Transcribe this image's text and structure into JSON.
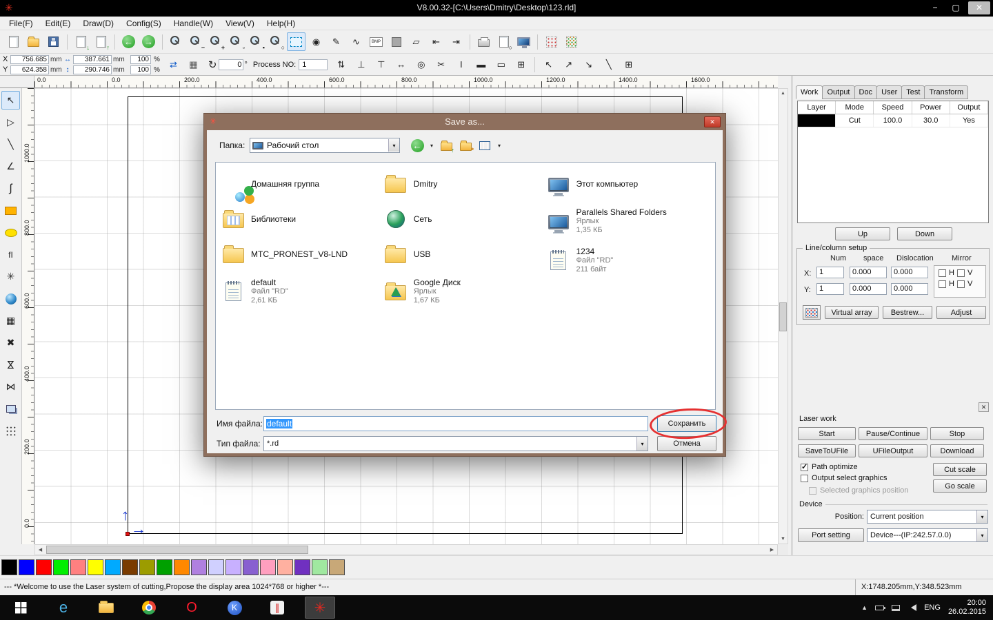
{
  "ui": {
    "logo_glyph": "✳",
    "close_glyph": "✕",
    "dropdown_arrow": "▾",
    "chevron_up": "▲",
    "scroll_left": "◀",
    "scroll_right": "▶",
    "scroll_up": "▲",
    "scroll_down": "▼"
  },
  "titlebar": {
    "title": "V8.00.32-[C:\\Users\\Dmitry\\Desktop\\123.rld]",
    "minimize": "−",
    "maximize": "▢",
    "close": "✕"
  },
  "menubar": {
    "items": [
      {
        "id": "file",
        "label": "File(F)"
      },
      {
        "id": "edit",
        "label": "Edit(E)"
      },
      {
        "id": "draw",
        "label": "Draw(D)"
      },
      {
        "id": "config",
        "label": "Config(S)"
      },
      {
        "id": "handle",
        "label": "Handle(W)"
      },
      {
        "id": "view",
        "label": "View(V)"
      },
      {
        "id": "help",
        "label": "Help(H)"
      }
    ]
  },
  "toolbar_main": {
    "icons": [
      {
        "n": "new-file-icon",
        "cls": "i-page"
      },
      {
        "n": "open-file-icon",
        "cls": "i-folder"
      },
      {
        "n": "save-file-icon",
        "cls": "i-floppy"
      },
      {
        "sep": true
      },
      {
        "n": "import-file-icon",
        "cls": "i-page",
        "g": "↓",
        "gc": "#1a8a1a",
        "p": "br"
      },
      {
        "n": "export-file-icon",
        "cls": "i-page",
        "g": "↑",
        "gc": "#1a8a1a",
        "p": "br"
      },
      {
        "sep": true
      },
      {
        "n": "view-back-icon",
        "cls": "i-circle-green",
        "g": "←",
        "gc": "#ffffff"
      },
      {
        "n": "view-forward-icon",
        "cls": "i-circle-green",
        "g": "→",
        "gc": "#ffffff"
      },
      {
        "sep": true
      },
      {
        "n": "zoom-window-icon",
        "cls": "i-mag"
      },
      {
        "n": "zoom-out-icon",
        "cls": "i-mag",
        "g": "−",
        "p": "br"
      },
      {
        "n": "zoom-in-icon",
        "cls": "i-mag",
        "g": "+",
        "p": "br"
      },
      {
        "n": "zoom-selection-icon",
        "cls": "i-mag",
        "g": "▫",
        "p": "br"
      },
      {
        "n": "zoom-page-icon",
        "cls": "i-mag",
        "g": "▪",
        "p": "br"
      },
      {
        "n": "zoom-all-icon",
        "cls": "i-mag",
        "g": "○",
        "p": "br"
      },
      {
        "n": "select-tool-icon",
        "cls": "i-selrect",
        "active": true
      },
      {
        "n": "node-tool-icon",
        "g": "◉"
      },
      {
        "n": "pen-tool-icon",
        "g": "✎"
      },
      {
        "n": "curve-tool-icon",
        "g": "∿"
      },
      {
        "n": "bmp-tool-icon",
        "cls": "i-bmpbox",
        "g": "BMP",
        "fs": 6
      },
      {
        "n": "fill-tool-icon",
        "cls": "i-graysq"
      },
      {
        "n": "edit-rect-icon",
        "g": "▱"
      },
      {
        "n": "dim-horizontal-icon",
        "g": "⇤"
      },
      {
        "n": "dim-vertical-icon",
        "g": "⇥"
      },
      {
        "sep": true
      },
      {
        "n": "print-icon",
        "cls": "i-printer"
      },
      {
        "n": "preview-icon",
        "cls": "i-page",
        "g": "○",
        "p": "br"
      },
      {
        "n": "display-icon",
        "cls": "i-monitor"
      },
      {
        "sep": true
      },
      {
        "n": "output-array-icon",
        "cls": "i-array1"
      },
      {
        "n": "preview-array-icon",
        "cls": "i-array2"
      }
    ]
  },
  "coords": {
    "x_label": "X",
    "y_label": "Y",
    "unit": "mm",
    "x_val1": "756.685",
    "x_val2": "387.661",
    "y_val1": "624.358",
    "y_val2": "290.746",
    "h_arrow": "↔",
    "v_arrow": "↕",
    "scale_x": "100",
    "scale_y": "100",
    "percent": "%",
    "rotate_icon": "↻",
    "rotate_val": "0",
    "degree": "°",
    "process_label": "Process NO:",
    "process_val": "1"
  },
  "toolbar_pre": {
    "icons": [
      {
        "n": "swap-xy-icon",
        "g": "⇄",
        "gc": "#0a58c8"
      },
      {
        "n": "size-table-icon",
        "g": "▦",
        "gc": "#555555"
      }
    ]
  },
  "toolbar_align": {
    "icons": [
      {
        "n": "flip-vertical-icon",
        "g": "⇅"
      },
      {
        "n": "align-bottom-icon",
        "g": "⊥"
      },
      {
        "n": "align-top-icon",
        "g": "⊤"
      },
      {
        "n": "distribute-horizontal-icon",
        "g": "↔"
      },
      {
        "n": "align-center-icon",
        "g": "◎"
      },
      {
        "n": "cut-path-icon",
        "g": "✂"
      },
      {
        "n": "text-cursor-icon",
        "g": "I"
      },
      {
        "n": "solid-rect-icon",
        "g": "▬"
      },
      {
        "n": "hollow-rect-icon",
        "g": "▭"
      },
      {
        "n": "grid-rect-icon",
        "g": "⊞"
      },
      {
        "sep": true
      },
      {
        "n": "corner-topleft-icon",
        "g": "↖"
      },
      {
        "n": "corner-topright-icon",
        "g": "↗"
      },
      {
        "n": "corner-bottomright-icon",
        "g": "↘"
      },
      {
        "n": "diagonal-icon",
        "g": "╲"
      },
      {
        "n": "align-grid-icon",
        "g": "⊞"
      }
    ]
  },
  "left_toolbar": {
    "icons": [
      {
        "n": "select-icon",
        "g": "↖",
        "active": true
      },
      {
        "n": "node-edit-icon",
        "g": "▷"
      },
      {
        "n": "draw-line-icon",
        "g": "╲"
      },
      {
        "n": "draw-polyline-icon",
        "g": "∠"
      },
      {
        "n": "draw-curve-icon",
        "g": "ʃ",
        "fs": 16
      },
      {
        "n": "draw-rectangle-icon",
        "cls": "i-rect-orange"
      },
      {
        "n": "draw-ellipse-icon",
        "cls": "i-ellipse-yellow"
      },
      {
        "n": "draw-text-icon",
        "g": "fI",
        "fs": 12
      },
      {
        "n": "draw-star-icon",
        "g": "✳",
        "gc": "#333333"
      },
      {
        "n": "capture-icon",
        "cls": "i-ball"
      },
      {
        "n": "grid-array-icon",
        "g": "▦"
      },
      {
        "n": "delete-icon",
        "g": "✖",
        "gc": "#222222"
      },
      {
        "n": "mirror-vertical-icon",
        "g": "⋈",
        "rot": 90
      },
      {
        "n": "mirror-horizontal-icon",
        "g": "⋈"
      },
      {
        "n": "offset-icon",
        "cls": "i-two-rects"
      },
      {
        "n": "array-copy-icon",
        "cls": "i-dots-grid"
      }
    ]
  },
  "rulers": {
    "h": [
      "0.0",
      "0.0",
      "200.0",
      "400.0",
      "600.0",
      "800.0",
      "1000.0",
      "1200.0",
      "1400.0",
      "1600.0"
    ],
    "v": [
      "1000.0",
      "800.0",
      "600.0",
      "400.0",
      "200.0",
      "0.0"
    ]
  },
  "dialog": {
    "title": "Save as...",
    "folder_label": "Папка:",
    "folder_value": "Рабочий стол",
    "nav_icons": [
      {
        "n": "back-icon",
        "cls": "i-circle-green",
        "g": "←",
        "gc": "#ffffff"
      },
      {
        "n": "back-dropdown-icon",
        "g": "▾",
        "fs": 8,
        "slim": true
      },
      {
        "n": "up-folder-icon",
        "cls": "i-folder",
        "g": "↑",
        "gc": "#1a8a1a",
        "p": "br"
      },
      {
        "n": "new-folder-icon",
        "cls": "i-folder",
        "g": "*",
        "gc": "#c87800",
        "p": "br"
      },
      {
        "n": "views-icon",
        "cls": "i-views"
      },
      {
        "n": "views-dropdown-icon",
        "g": "▾",
        "fs": 8,
        "slim": true
      }
    ],
    "columns": [
      [
        {
          "id": "homegroup",
          "icon": "homegroup",
          "name": "Домашняя группа"
        },
        {
          "id": "libraries",
          "icon": "library",
          "name": "Библиотеки"
        },
        {
          "id": "mtc-pronest-folder",
          "icon": "folder",
          "name": "MTC_PRONEST_V8-LND"
        },
        {
          "id": "default-rd-file",
          "icon": "notepad",
          "name": "default",
          "details": [
            "Файл \"RD\"",
            "2,61 КБ"
          ]
        }
      ],
      [
        {
          "id": "dmitry-folder",
          "icon": "folder",
          "name": "Dmitry"
        },
        {
          "id": "network",
          "icon": "network",
          "name": "Сеть"
        },
        {
          "id": "usb-folder",
          "icon": "folder",
          "name": "USB"
        },
        {
          "id": "google-drive",
          "icon": "gdrive",
          "name": "Google Диск",
          "details": [
            "Ярлык",
            "1,67 КБ"
          ]
        }
      ],
      [
        {
          "id": "this-pc",
          "icon": "computer",
          "name": "Этот компьютер"
        },
        {
          "id": "parallels-shared-folders",
          "icon": "computer",
          "name": "Parallels Shared Folders",
          "details": [
            "Ярлык",
            "1,35 КБ"
          ]
        },
        {
          "id": "file-1234",
          "icon": "notepad",
          "name": "1234",
          "details": [
            "Файл \"RD\"",
            "211 байт"
          ]
        }
      ]
    ],
    "filename_label": "Имя файла:",
    "filename_value": "default",
    "filetype_label": "Тип файла:",
    "filetype_value": "*.rd",
    "save_label": "Сохранить",
    "cancel_label": "Отмена"
  },
  "right_panel": {
    "tabs": [
      {
        "id": "work",
        "label": "Work",
        "active": true
      },
      {
        "id": "output",
        "label": "Output"
      },
      {
        "id": "doc",
        "label": "Doc"
      },
      {
        "id": "user",
        "label": "User"
      },
      {
        "id": "test",
        "label": "Test"
      },
      {
        "id": "transform",
        "label": "Transform"
      }
    ],
    "layer_table": {
      "headers": [
        "Layer",
        "Mode",
        "Speed",
        "Power",
        "Output"
      ],
      "rows": [
        {
          "layer_color": "#000000",
          "mode": "Cut",
          "speed": "100.0",
          "power": "30.0",
          "output": "Yes"
        }
      ]
    },
    "up_label": "Up",
    "down_label": "Down",
    "line_column_setup": {
      "title": "Line/column setup",
      "col_headers": [
        "Num",
        "space",
        "Dislocation",
        "Mirror"
      ],
      "rows": [
        {
          "axis": "X:",
          "num": "1",
          "space": "0.000",
          "dislocation": "0.000",
          "h_label": "H",
          "v_label": "V",
          "h_checked": false,
          "v_checked": false
        },
        {
          "axis": "Y:",
          "num": "1",
          "space": "0.000",
          "dislocation": "0.000",
          "h_label": "H",
          "v_label": "V",
          "h_checked": false,
          "v_checked": false
        }
      ],
      "virtual_array_label": "Virtual array",
      "bestrew_label": "Bestrew...",
      "adjust_label": "Adjust"
    },
    "laser_work": {
      "title": "Laser work",
      "start_label": "Start",
      "pause_label": "Pause/Continue",
      "stop_label": "Stop",
      "save_ufile_label": "SaveToUFile",
      "ufile_output_label": "UFileOutput",
      "download_label": "Download",
      "path_optimize": {
        "label": "Path optimize",
        "checked": true
      },
      "output_select": {
        "label": "Output select graphics",
        "checked": false
      },
      "selected_position": {
        "label": "Selected graphics position",
        "checked": false
      },
      "cut_scale_label": "Cut scale",
      "go_scale_label": "Go scale"
    },
    "device": {
      "title": "Device",
      "position_label": "Position:",
      "position_value": "Current position",
      "port_setting_label": "Port setting",
      "device_value": "Device---(IP:242.57.0.0)"
    }
  },
  "palette": {
    "colors": [
      "#000000",
      "#0000ff",
      "#ff0000",
      "#00ee00",
      "#ff8080",
      "#ffff00",
      "#00aaff",
      "#7a3b00",
      "#9c9c00",
      "#00a000",
      "#ff8800",
      "#b080e0",
      "#d0d0ff",
      "#c8b0ff",
      "#8860d0",
      "#ff9fbf",
      "#ffb0a0",
      "#7030c0",
      "#a0e8a0",
      "#c8a878"
    ]
  },
  "status_bar": {
    "message": "--- *Welcome to use the Laser system of cutting,Propose the display area 1024*768 or higher *---",
    "coordinates": "X:1748.205mm,Y:348.523mm"
  },
  "taskbar": {
    "apps": [
      {
        "n": "start-button",
        "cls": "ic-win"
      },
      {
        "n": "ie-taskbar-button",
        "cls": "ic-ie-txt",
        "g": "e",
        "gc": "#4db4e8",
        "fs": 22,
        "txt": true
      },
      {
        "n": "explorer-taskbar-button",
        "cls": "ic-explorer"
      },
      {
        "n": "chrome-taskbar-button",
        "cls": "ic-chrome"
      },
      {
        "n": "opera-taskbar-button",
        "cls": "ic-opera-txt",
        "g": "O",
        "gc": "#ff1b2d",
        "fs": 20,
        "txt": true
      },
      {
        "n": "kmplayer-taskbar-button",
        "cls": "ic-kmp",
        "g": "K",
        "gc": "#ffffff",
        "fs": 12
      },
      {
        "n": "parallels-taskbar-button",
        "cls": "ic-parallels",
        "g": "∥",
        "gc": "#d82020",
        "fs": 14
      },
      {
        "n": "rdworks-taskbar-button",
        "g": "✳",
        "gc": "#e82820",
        "fs": 20,
        "active": true
      }
    ],
    "tray": {
      "lang": "ENG",
      "time": "20:00",
      "date": "26.02.2015"
    }
  }
}
